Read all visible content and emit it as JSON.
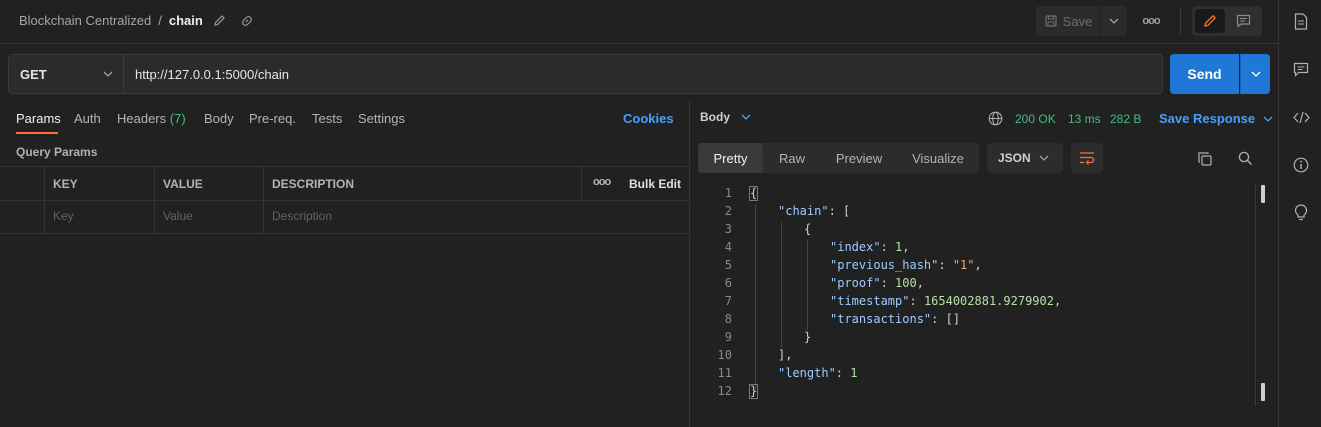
{
  "header": {
    "collection": "Blockchain Centralized",
    "separator": "/",
    "request_name": "chain",
    "save_label": "Save",
    "more_label": "ooo"
  },
  "request": {
    "method": "GET",
    "url": "http://127.0.0.1:5000/chain",
    "send_label": "Send",
    "tabs": [
      {
        "label": "Params"
      },
      {
        "label": "Auth"
      },
      {
        "label": "Headers",
        "count": "(7)"
      },
      {
        "label": "Body"
      },
      {
        "label": "Pre-req."
      },
      {
        "label": "Tests"
      },
      {
        "label": "Settings"
      }
    ],
    "cookies_label": "Cookies",
    "query_params_title": "Query Params",
    "table": {
      "columns": [
        "KEY",
        "VALUE",
        "DESCRIPTION"
      ],
      "more_label": "ooo",
      "bulk_edit_label": "Bulk Edit",
      "placeholders": [
        "Key",
        "Value",
        "Description"
      ]
    }
  },
  "response": {
    "body_label": "Body",
    "status": "200 OK",
    "time": "13 ms",
    "size": "282 B",
    "save_response_label": "Save Response",
    "view_tabs": [
      "Pretty",
      "Raw",
      "Preview",
      "Visualize"
    ],
    "active_view": "Pretty",
    "format": "JSON",
    "line_numbers": [
      "1",
      "2",
      "3",
      "4",
      "5",
      "6",
      "7",
      "8",
      "9",
      "10",
      "11",
      "12"
    ],
    "json": {
      "l1": "{",
      "l2_key": "\"chain\"",
      "l2_rest": ": [",
      "l3": "{",
      "l4_key": "\"index\"",
      "l4_val": "1",
      "l5_key": "\"previous_hash\"",
      "l5_val": "\"1\"",
      "l6_key": "\"proof\"",
      "l6_val": "100",
      "l7_key": "\"timestamp\"",
      "l7_val": "1654002881.9279902",
      "l8_key": "\"transactions\"",
      "l8_val": "[]",
      "l9": "}",
      "l10": "],",
      "l11_key": "\"length\"",
      "l11_val": "1",
      "l12": "}"
    }
  },
  "colors": {
    "accent": "#ff6c37",
    "send": "#1f77d6",
    "link": "#4a9df8",
    "success": "#3fbf7f"
  }
}
